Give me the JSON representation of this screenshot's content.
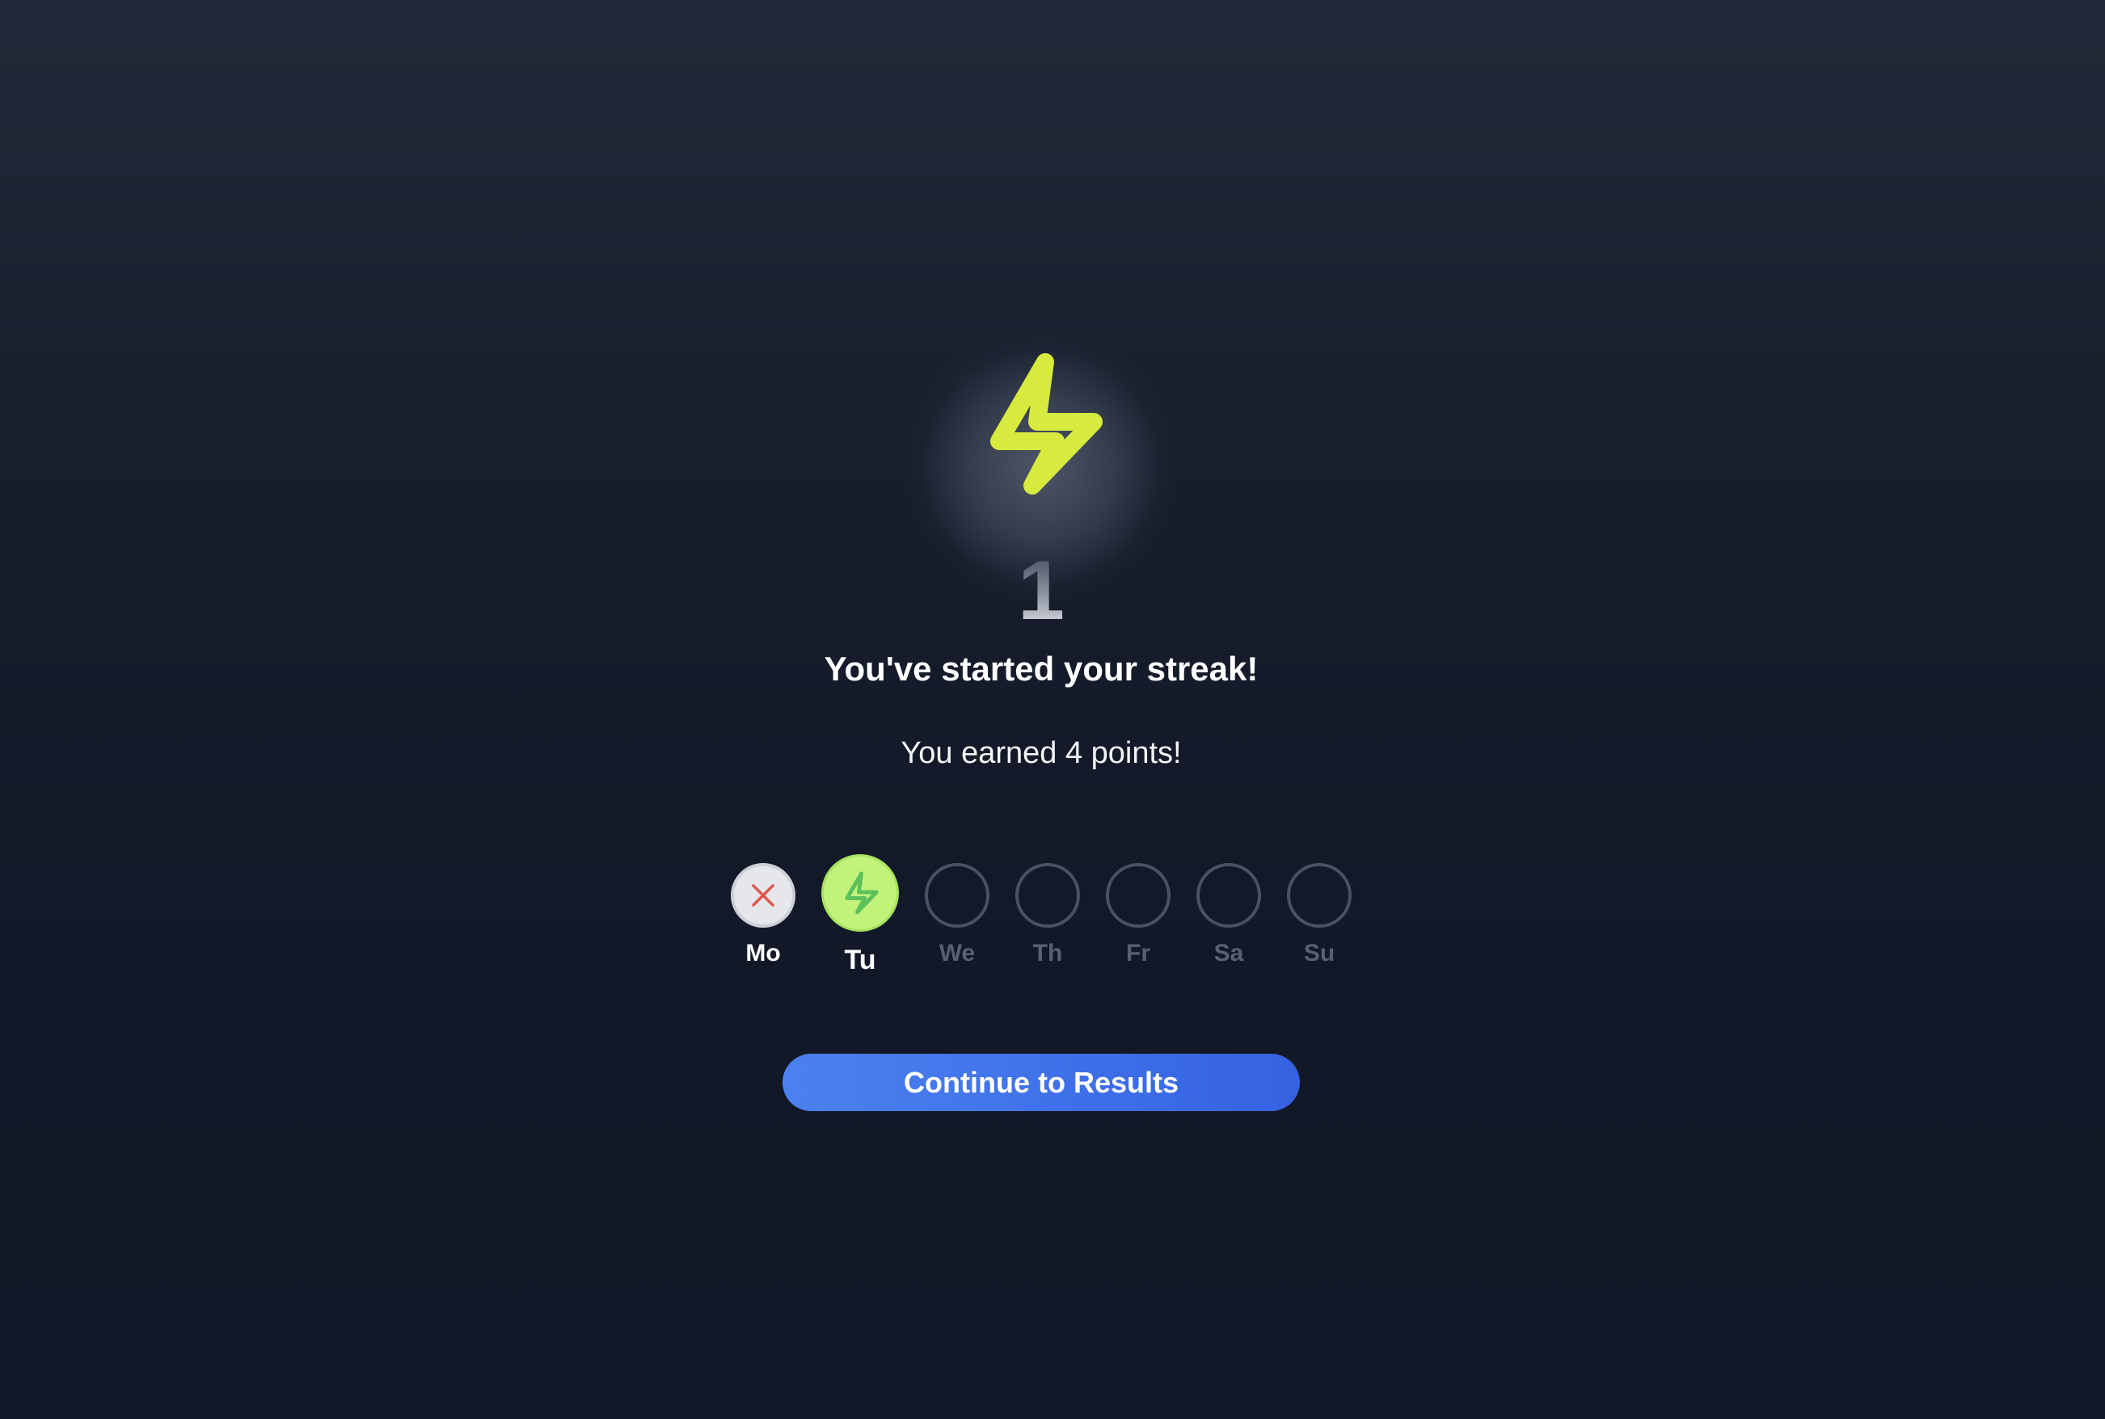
{
  "streak": {
    "count": "1",
    "title": "You've started your streak!",
    "subtitle": "You earned 4 points!",
    "icon": "lightning-bolt-icon",
    "accent_color": "#d7ea3e"
  },
  "week": {
    "days": [
      {
        "label": "Mo",
        "status": "missed",
        "icon": "close-icon"
      },
      {
        "label": "Tu",
        "status": "completed",
        "icon": "lightning-bolt-icon"
      },
      {
        "label": "We",
        "status": "upcoming"
      },
      {
        "label": "Th",
        "status": "upcoming"
      },
      {
        "label": "Fr",
        "status": "upcoming"
      },
      {
        "label": "Sa",
        "status": "upcoming"
      },
      {
        "label": "Su",
        "status": "upcoming"
      }
    ]
  },
  "actions": {
    "continue_label": "Continue to Results",
    "continue_color": "#4277ea"
  }
}
